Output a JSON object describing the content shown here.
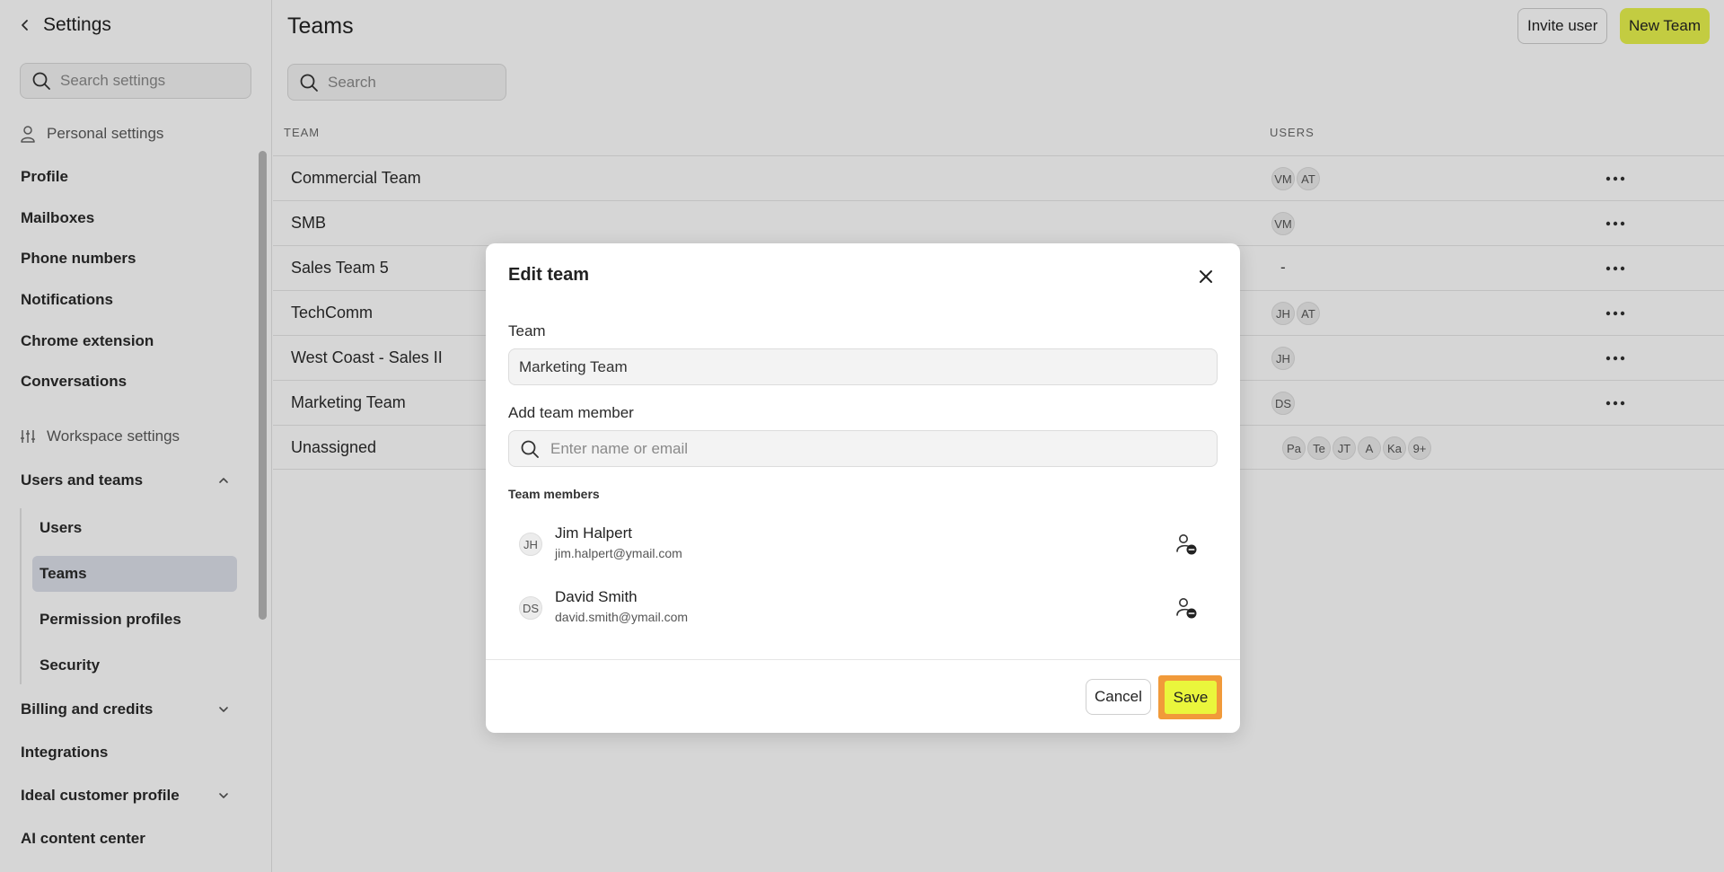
{
  "sidebar": {
    "title": "Settings",
    "search_placeholder": "Search settings",
    "personal_label": "Personal settings",
    "personal_items": [
      "Profile",
      "Mailboxes",
      "Phone numbers",
      "Notifications",
      "Chrome extension",
      "Conversations"
    ],
    "workspace_label": "Workspace settings",
    "users_and_teams": "Users and teams",
    "sub_items": [
      "Users",
      "Teams",
      "Permission profiles",
      "Security"
    ],
    "active_sub": "Teams",
    "billing": "Billing and credits",
    "integrations": "Integrations",
    "icp": "Ideal customer profile",
    "ai_center": "AI content center"
  },
  "main": {
    "title": "Teams",
    "search_placeholder": "Search",
    "invite_label": "Invite user",
    "new_team_label": "New Team",
    "col_team": "TEAM",
    "col_users": "USERS",
    "rows": [
      {
        "name": "Commercial Team",
        "users": [
          "VM",
          "AT"
        ]
      },
      {
        "name": "SMB",
        "users": [
          "VM"
        ]
      },
      {
        "name": "Sales Team 5",
        "users_text": "-"
      },
      {
        "name": "TechComm",
        "users": [
          "JH",
          "AT"
        ]
      },
      {
        "name": "West Coast - Sales II",
        "users": [
          "JH"
        ]
      },
      {
        "name": "Marketing Team",
        "users": [
          "DS"
        ]
      },
      {
        "name": "Unassigned",
        "users": [
          "Pa",
          "Te",
          "JT",
          "A",
          "Ka",
          "9+"
        ]
      }
    ]
  },
  "modal": {
    "title": "Edit team",
    "team_label": "Team",
    "team_value": "Marketing Team",
    "add_member_label": "Add team member",
    "add_member_placeholder": "Enter name or email",
    "members_label": "Team members",
    "members": [
      {
        "initials": "JH",
        "name": "Jim Halpert",
        "email": "jim.halpert@ymail.com"
      },
      {
        "initials": "DS",
        "name": "David Smith",
        "email": "david.smith@ymail.com"
      }
    ],
    "cancel_label": "Cancel",
    "save_label": "Save"
  },
  "colors": {
    "accent": "#eaf63c",
    "highlight": "#f19a3a",
    "active_nav": "#dde0ea"
  }
}
